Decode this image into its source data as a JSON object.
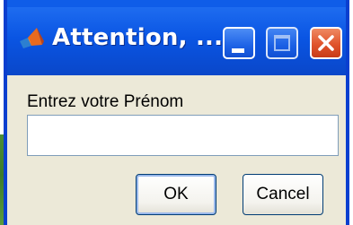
{
  "window": {
    "title": "Attention, ...",
    "app_icon": "matlab-logo-icon",
    "controls": {
      "minimize": "minimize-icon",
      "maximize": "maximize-icon",
      "close": "close-icon"
    }
  },
  "dialog": {
    "prompt": "Entrez votre Prénom",
    "input_value": "",
    "ok_label": "OK",
    "cancel_label": "Cancel"
  },
  "colors": {
    "titlebar": "#0a55e3",
    "close_button": "#e0532b",
    "dialog_background": "#ece9d8"
  }
}
